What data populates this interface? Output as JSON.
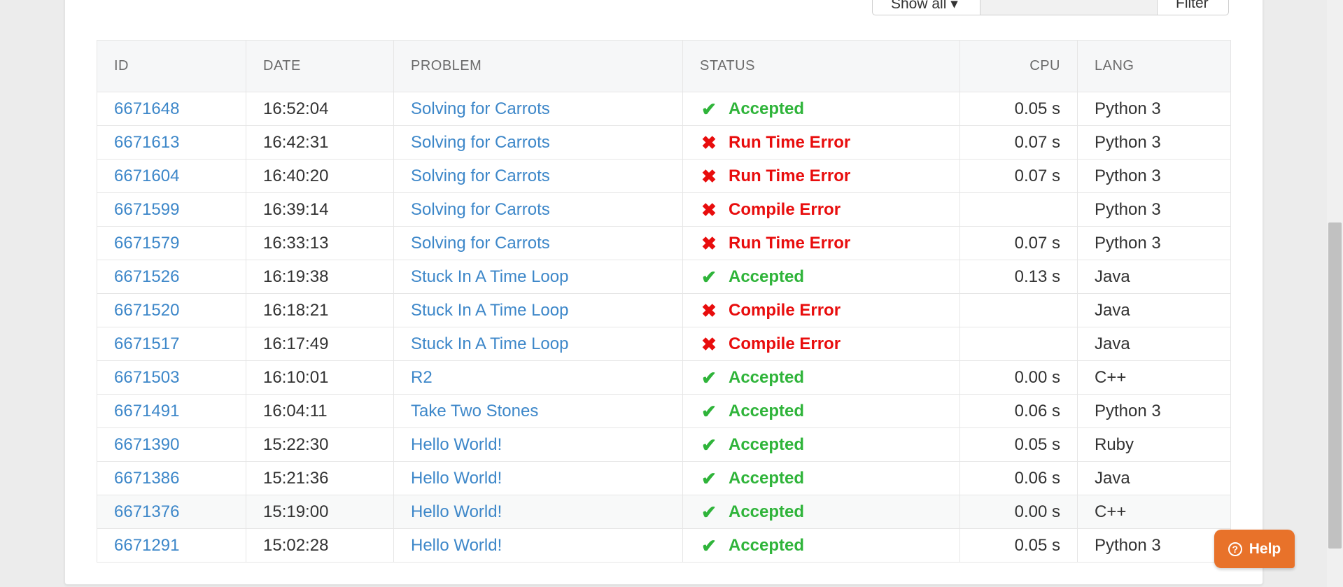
{
  "filter_bar": {
    "show_label": "Show all ▾",
    "search_value": "",
    "filter_label": "Filter"
  },
  "table": {
    "headers": {
      "id": "ID",
      "date": "DATE",
      "problem": "PROBLEM",
      "status": "STATUS",
      "cpu": "CPU",
      "lang": "LANG"
    },
    "rows": [
      {
        "id": "6671648",
        "date": "16:52:04",
        "problem": "Solving for Carrots",
        "status": "Accepted",
        "status_icon": "check-icon",
        "ok": true,
        "cpu": "0.05 s",
        "lang": "Python 3"
      },
      {
        "id": "6671613",
        "date": "16:42:31",
        "problem": "Solving for Carrots",
        "status": "Run Time Error",
        "status_icon": "cross-icon",
        "ok": false,
        "cpu": "0.07 s",
        "lang": "Python 3"
      },
      {
        "id": "6671604",
        "date": "16:40:20",
        "problem": "Solving for Carrots",
        "status": "Run Time Error",
        "status_icon": "cross-icon",
        "ok": false,
        "cpu": "0.07 s",
        "lang": "Python 3"
      },
      {
        "id": "6671599",
        "date": "16:39:14",
        "problem": "Solving for Carrots",
        "status": "Compile Error",
        "status_icon": "cross-icon",
        "ok": false,
        "cpu": "",
        "lang": "Python 3"
      },
      {
        "id": "6671579",
        "date": "16:33:13",
        "problem": "Solving for Carrots",
        "status": "Run Time Error",
        "status_icon": "cross-icon",
        "ok": false,
        "cpu": "0.07 s",
        "lang": "Python 3"
      },
      {
        "id": "6671526",
        "date": "16:19:38",
        "problem": "Stuck In A Time Loop",
        "status": "Accepted",
        "status_icon": "check-icon",
        "ok": true,
        "cpu": "0.13 s",
        "lang": "Java"
      },
      {
        "id": "6671520",
        "date": "16:18:21",
        "problem": "Stuck In A Time Loop",
        "status": "Compile Error",
        "status_icon": "cross-icon",
        "ok": false,
        "cpu": "",
        "lang": "Java"
      },
      {
        "id": "6671517",
        "date": "16:17:49",
        "problem": "Stuck In A Time Loop",
        "status": "Compile Error",
        "status_icon": "cross-icon",
        "ok": false,
        "cpu": "",
        "lang": "Java"
      },
      {
        "id": "6671503",
        "date": "16:10:01",
        "problem": "R2",
        "status": "Accepted",
        "status_icon": "check-icon",
        "ok": true,
        "cpu": "0.00 s",
        "lang": "C++"
      },
      {
        "id": "6671491",
        "date": "16:04:11",
        "problem": "Take Two Stones",
        "status": "Accepted",
        "status_icon": "check-icon",
        "ok": true,
        "cpu": "0.06 s",
        "lang": "Python 3"
      },
      {
        "id": "6671390",
        "date": "15:22:30",
        "problem": "Hello World!",
        "status": "Accepted",
        "status_icon": "check-icon",
        "ok": true,
        "cpu": "0.05 s",
        "lang": "Ruby"
      },
      {
        "id": "6671386",
        "date": "15:21:36",
        "problem": "Hello World!",
        "status": "Accepted",
        "status_icon": "check-icon",
        "ok": true,
        "cpu": "0.06 s",
        "lang": "Java"
      },
      {
        "id": "6671376",
        "date": "15:19:00",
        "problem": "Hello World!",
        "status": "Accepted",
        "status_icon": "check-icon",
        "ok": true,
        "cpu": "0.00 s",
        "lang": "C++"
      },
      {
        "id": "6671291",
        "date": "15:02:28",
        "problem": "Hello World!",
        "status": "Accepted",
        "status_icon": "check-icon",
        "ok": true,
        "cpu": "0.05 s",
        "lang": "Python 3"
      }
    ]
  },
  "help_button": {
    "label": "Help",
    "icon": "question-circle-icon"
  },
  "colors": {
    "accepted": "#2fb43a",
    "error": "#e80d0d",
    "link": "#3d87c9",
    "help": "#e8722a"
  }
}
